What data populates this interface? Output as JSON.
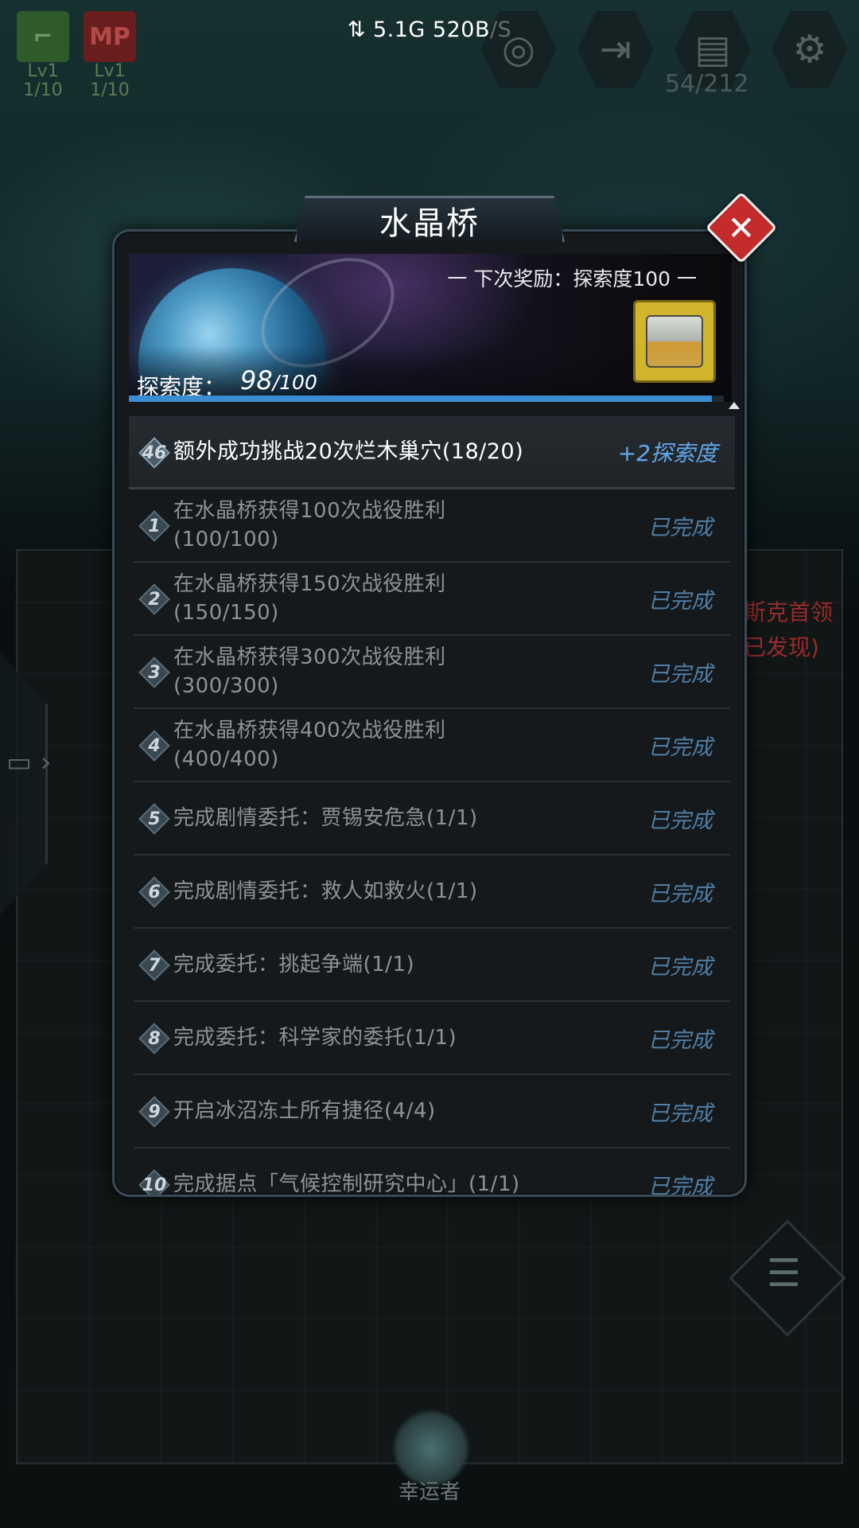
{
  "status_bar": {
    "network": "⇅ 5.1G 520B/S"
  },
  "hud": {
    "weapon_slots": [
      {
        "level": "Lv1",
        "count": "1/10",
        "color": "#2f5a2a"
      },
      {
        "level": "Lv1",
        "count": "1/10",
        "color": "#6a1d1d"
      }
    ],
    "bag_count": "54/212",
    "icons": [
      "target-icon",
      "exit-icon",
      "bag-icon",
      "gear-icon"
    ]
  },
  "background": {
    "side_text_line1": "斯克首领",
    "side_text_line2": "已发现)",
    "lucky_label": "幸运者"
  },
  "modal": {
    "title": "水晶桥",
    "close_label": "✕",
    "next_reward": "一 下次奖励：探索度100 一",
    "explore_label": "探索度：",
    "explore_current": "98",
    "explore_total": "/100",
    "explore_progress": 0.98,
    "colors": {
      "accent": "#62a8ec",
      "done": "#4f7fa6",
      "close": "#c42b2b",
      "progress": "#3b8cd2"
    }
  },
  "tasks": [
    {
      "num": "46",
      "line1": "额外成功挑战20次烂木巢穴(18/20)",
      "line2": "",
      "status": "+2探索度"
    },
    {
      "num": "1",
      "line1": "在水晶桥获得100次战役胜利",
      "line2": "(100/100)",
      "status": "已完成"
    },
    {
      "num": "2",
      "line1": "在水晶桥获得150次战役胜利",
      "line2": "(150/150)",
      "status": "已完成"
    },
    {
      "num": "3",
      "line1": "在水晶桥获得300次战役胜利",
      "line2": "(300/300)",
      "status": "已完成"
    },
    {
      "num": "4",
      "line1": "在水晶桥获得400次战役胜利",
      "line2": "(400/400)",
      "status": "已完成"
    },
    {
      "num": "5",
      "line1": "完成剧情委托：贾锡安危急(1/1)",
      "line2": "",
      "status": "已完成"
    },
    {
      "num": "6",
      "line1": "完成剧情委托：救人如救火(1/1)",
      "line2": "",
      "status": "已完成"
    },
    {
      "num": "7",
      "line1": "完成委托：挑起争端(1/1)",
      "line2": "",
      "status": "已完成"
    },
    {
      "num": "8",
      "line1": "完成委托：科学家的委托(1/1)",
      "line2": "",
      "status": "已完成"
    },
    {
      "num": "9",
      "line1": "开启冰沼冻土所有捷径(4/4)",
      "line2": "",
      "status": "已完成"
    },
    {
      "num": "10",
      "line1": "完成据点「气候控制研究中心」(1/1)",
      "line2": "",
      "status": "已完成"
    }
  ]
}
